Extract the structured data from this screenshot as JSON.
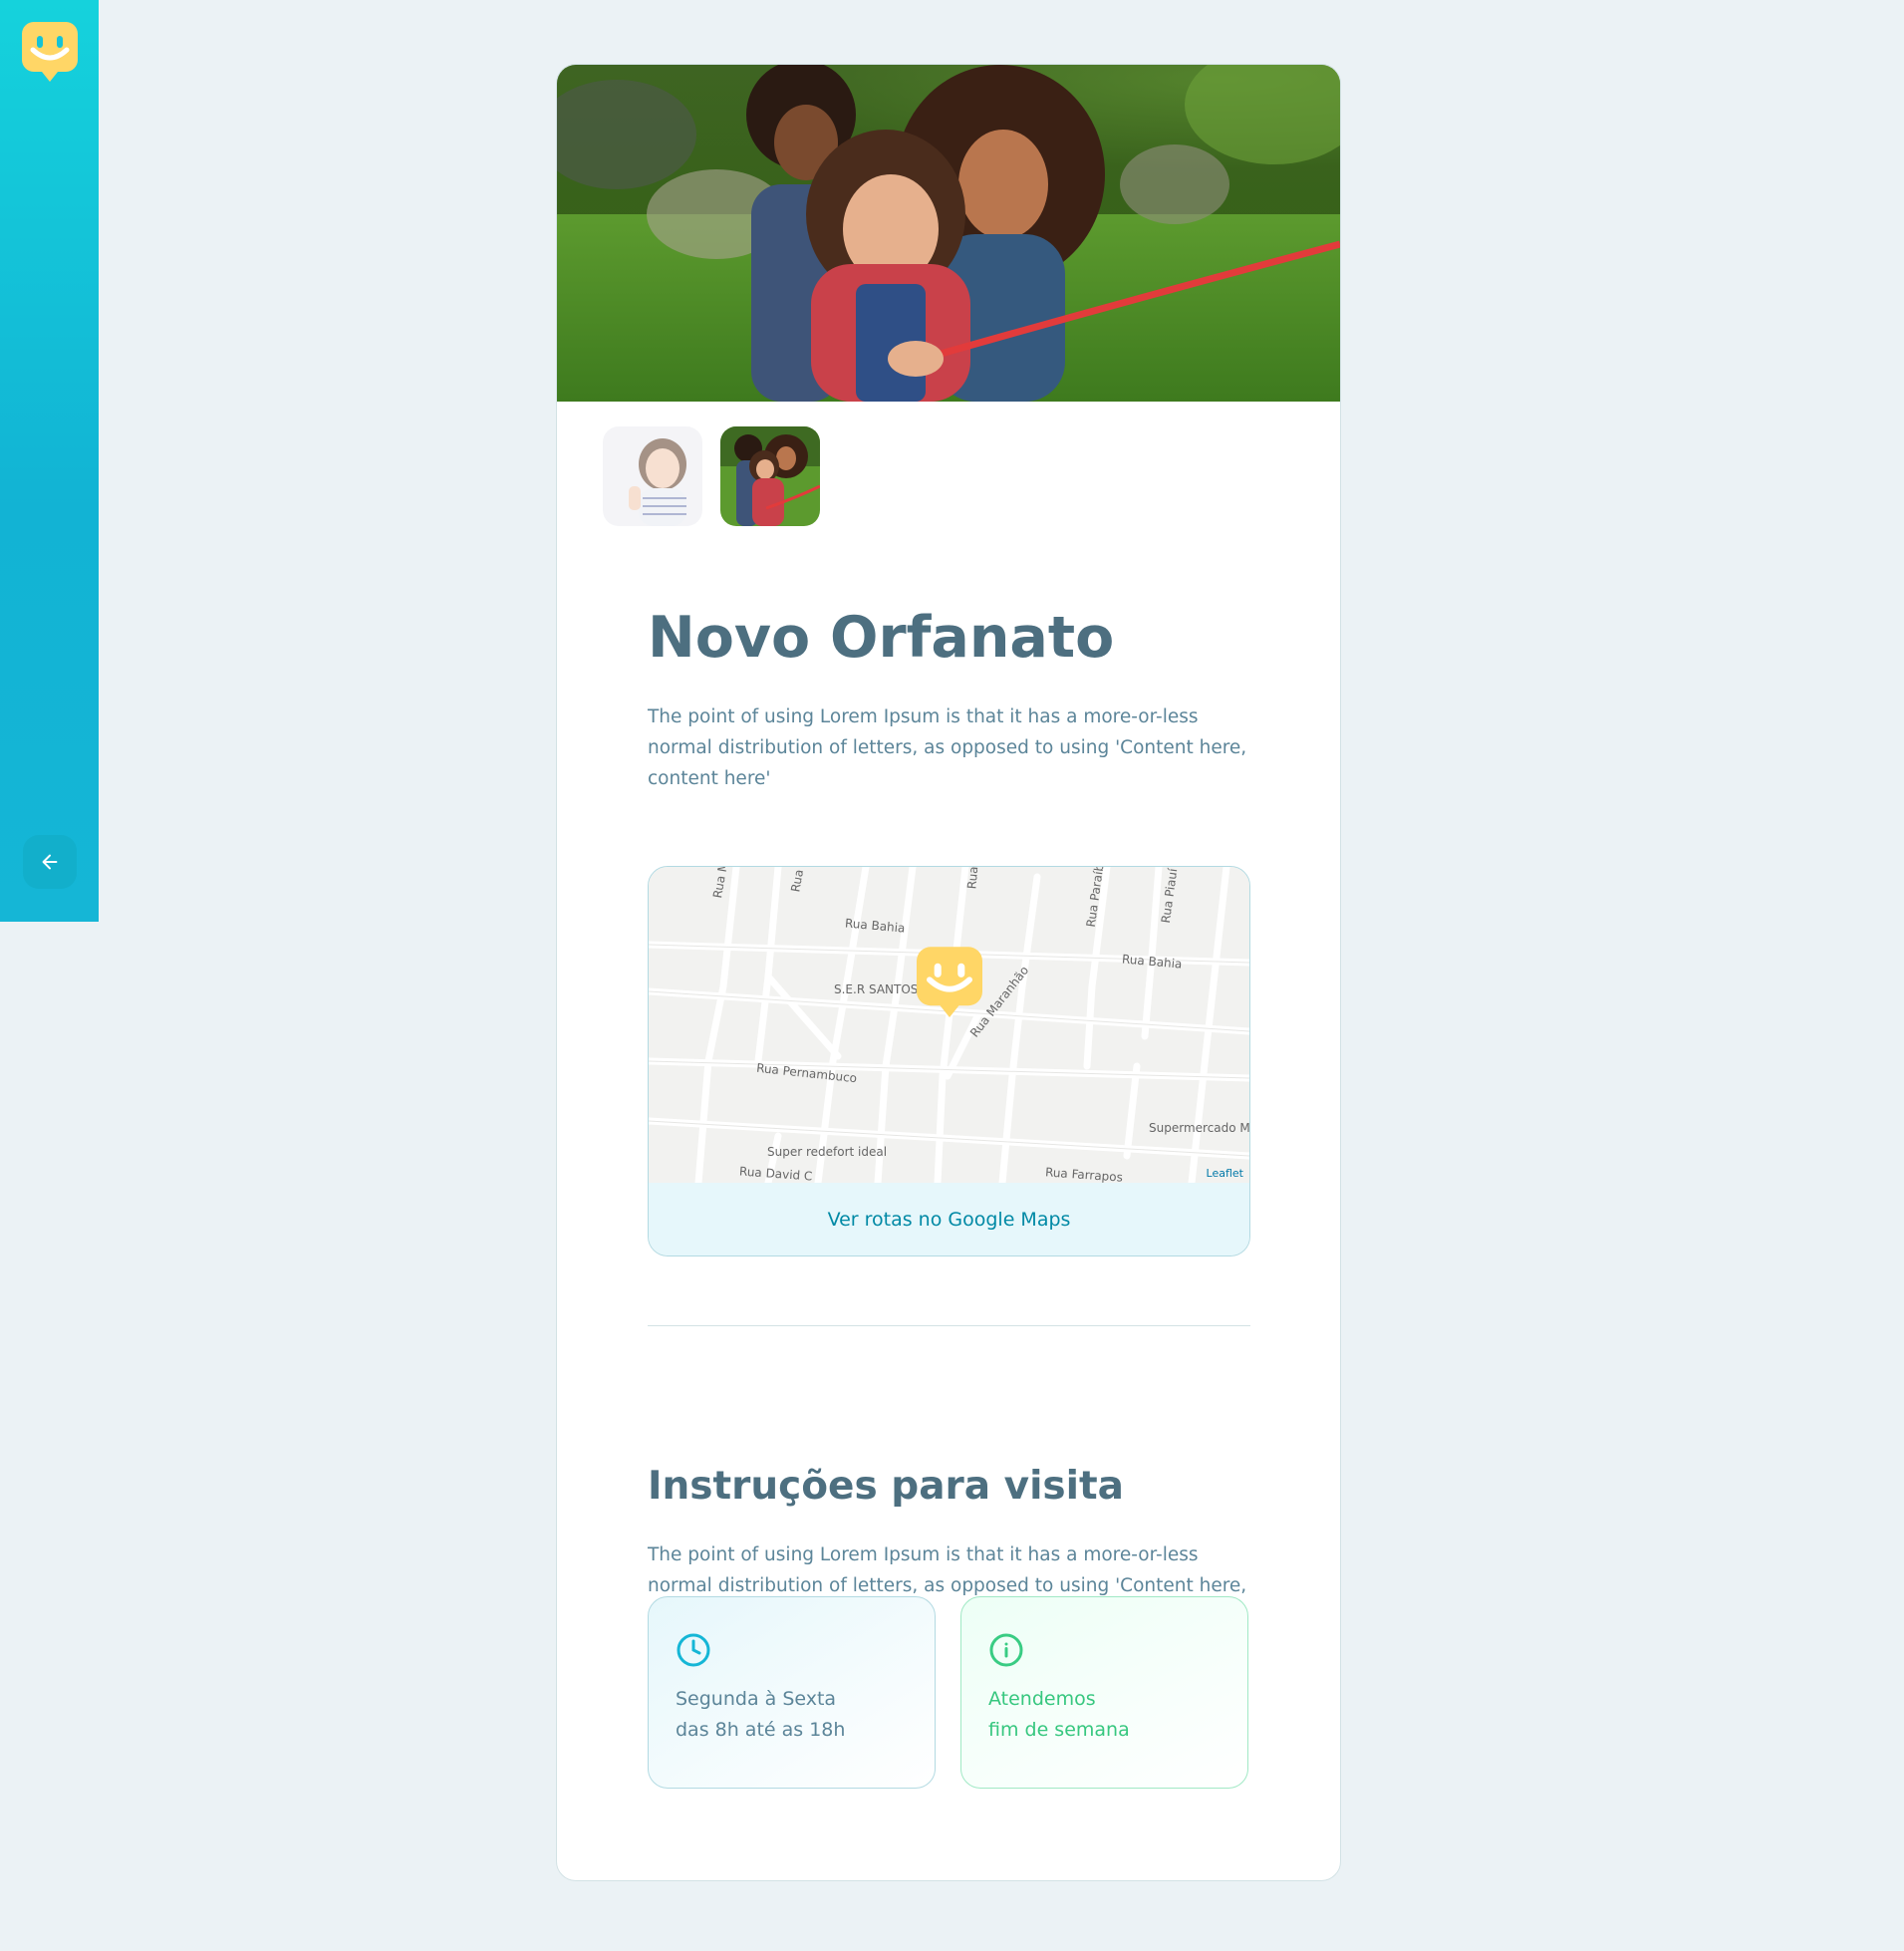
{
  "sidebar": {
    "logo_name": "happy-marker-logo",
    "back_button_label": "Voltar"
  },
  "gallery": {
    "active_index": 1,
    "thumbnail_count": 2
  },
  "orphanage": {
    "name": "Novo Orfanato",
    "about": "The point of using Lorem Ipsum is that it has a more-or-less normal distribution of letters, as opposed to using 'Content here, content here'"
  },
  "map": {
    "labels": {
      "minas_gerais": "Rua Minas Gerais",
      "sao": "Rua São",
      "ce": "Rua Ce",
      "paraiba": "Rua Paraíba",
      "piaui": "Rua Piauí",
      "bahia_1": "Rua Bahia",
      "bahia_2": "Rua Bahia",
      "ser_santos": "S.E.R SANTOS",
      "maranhao": "Rua Maranhão",
      "pernambuco": "Rua Pernambuco",
      "supermercado": "Supermercado M",
      "redefort": "Super redefort ideal",
      "david": "Rua David C",
      "farrapos": "Rua Farrapos"
    },
    "attribution": "Leaflet",
    "route_link": "Ver rotas no Google Maps"
  },
  "visit": {
    "title": "Instruções para visita",
    "instructions": "The point of using Lorem Ipsum is that it has a more-or-less normal distribution of letters, as opposed to using 'Content here, content here'",
    "hours_line1": "Segunda à Sexta",
    "hours_line2": "das 8h até as 18h",
    "weekend_line1": "Atendemos",
    "weekend_line2": "fim de semana"
  },
  "colors": {
    "sidebar_top": "#15d2dc",
    "sidebar_bottom": "#15b6d6",
    "title": "#4d6f80",
    "text": "#5c8599",
    "brand_yellow": "#ffd666",
    "link": "#0089a5",
    "green": "#37c77f"
  }
}
